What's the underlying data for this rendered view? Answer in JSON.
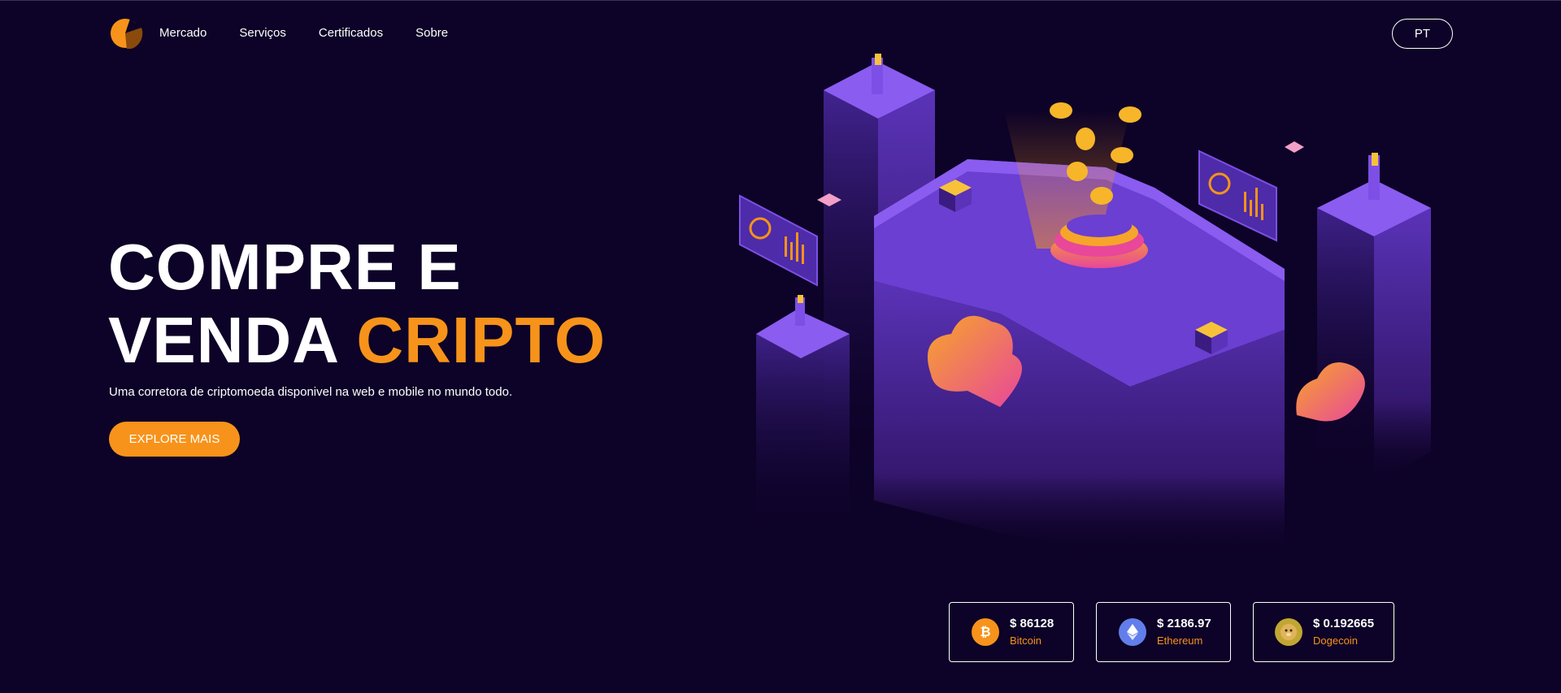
{
  "nav": {
    "links": [
      "Mercado",
      "Serviços",
      "Certificados",
      "Sobre"
    ],
    "language": "PT"
  },
  "hero": {
    "title_line1": "COMPRE E",
    "title_line2_white": "VENDA",
    "title_line2_accent": "CRIPTO",
    "subtitle": "Uma corretora de criptomoeda disponivel na web e mobile no mundo todo.",
    "cta": "EXPLORE MAIS"
  },
  "tickers": [
    {
      "price": "$ 86128",
      "name": "Bitcoin",
      "icon": "bitcoin-icon"
    },
    {
      "price": "$ 2186.97",
      "name": "Ethereum",
      "icon": "ethereum-icon"
    },
    {
      "price": "$ 0.192665",
      "name": "Dogecoin",
      "icon": "dogecoin-icon"
    }
  ],
  "colors": {
    "background": "#0d0227",
    "accent": "#f7931a",
    "text": "#ffffff",
    "illustration_purple": "#6a3fd1",
    "illustration_pink": "#e8479a"
  }
}
